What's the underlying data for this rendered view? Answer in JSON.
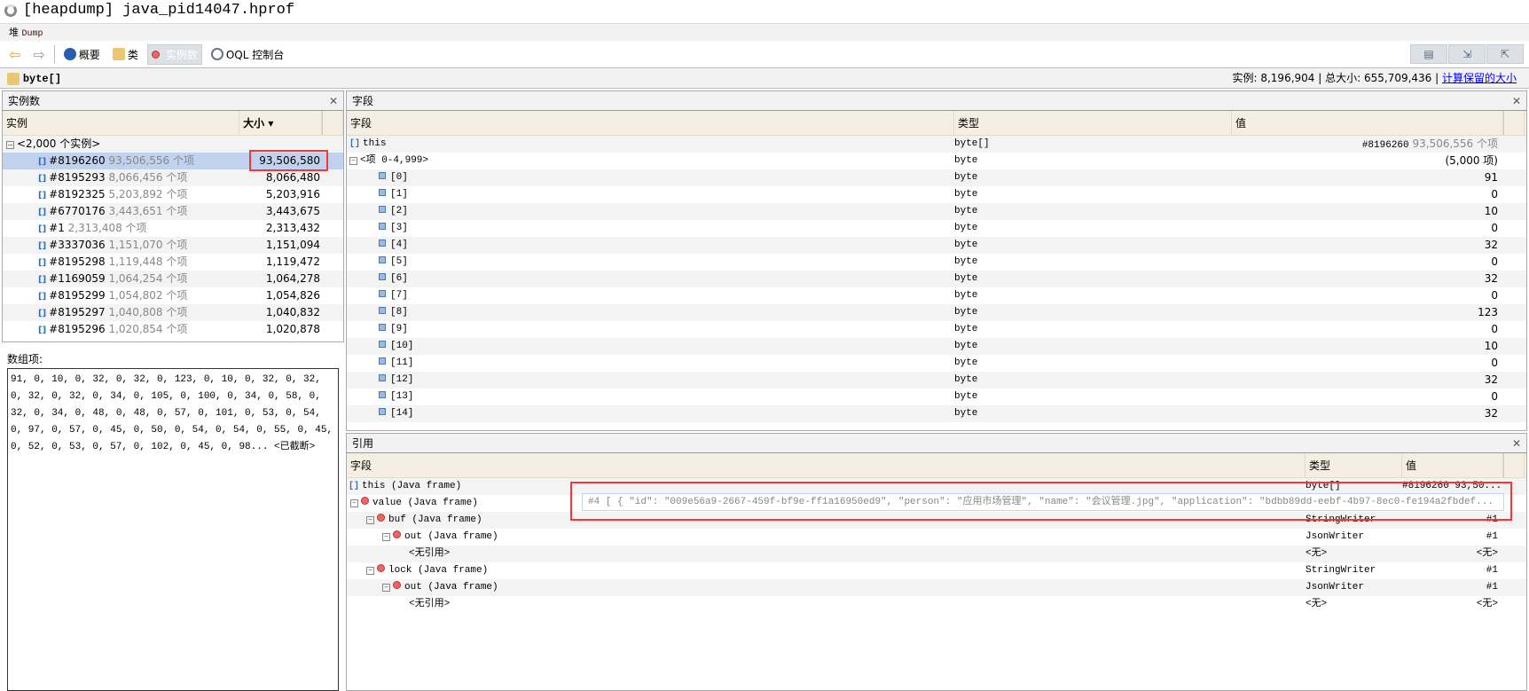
{
  "title": "[heapdump] java_pid14047.hprof",
  "tab": {
    "prefix": "堆",
    "label": "Dump"
  },
  "toolbar": {
    "summary": "概要",
    "classes": "类",
    "instances": "实例数",
    "oql": "OQL 控制台"
  },
  "class_bar": {
    "class_name": "byte[]",
    "instances_label": "实例:",
    "instances": "8,196,904",
    "total_label": "总大小:",
    "total": "655,709,436",
    "compute_link": "计算保留的大小"
  },
  "instances_panel": {
    "title": "实例数",
    "col_instance": "实例",
    "col_size": "大小",
    "group": "<2,000 个实例>",
    "rows": [
      {
        "id": "#8196260",
        "items": "93,506,556 个项",
        "size": "93,506,580"
      },
      {
        "id": "#8195293",
        "items": "8,066,456 个项",
        "size": "8,066,480"
      },
      {
        "id": "#8192325",
        "items": "5,203,892 个项",
        "size": "5,203,916"
      },
      {
        "id": "#6770176",
        "items": "3,443,651 个项",
        "size": "3,443,675"
      },
      {
        "id": "#1",
        "items": "2,313,408 个项",
        "size": "2,313,432"
      },
      {
        "id": "#3337036",
        "items": "1,151,070 个项",
        "size": "1,151,094"
      },
      {
        "id": "#8195298",
        "items": "1,119,448 个项",
        "size": "1,119,472"
      },
      {
        "id": "#1169059",
        "items": "1,064,254 个项",
        "size": "1,064,278"
      },
      {
        "id": "#8195299",
        "items": "1,054,802 个项",
        "size": "1,054,826"
      },
      {
        "id": "#8195297",
        "items": "1,040,808 个项",
        "size": "1,040,832"
      },
      {
        "id": "#8195296",
        "items": "1,020,854 个项",
        "size": "1,020,878"
      }
    ]
  },
  "array_items": {
    "label": "数组项:",
    "text": "91, 0, 10, 0, 32, 0, 32, 0, 123, 0, 10, 0, 32, 0, 32, 0, 32, 0, 32, 0, 34, 0, 105, 0, 100, 0, 34, 0, 58, 0, 32, 0, 34, 0, 48, 0, 48, 0, 57, 0, 101, 0, 53, 0, 54, 0, 97, 0, 57, 0, 45, 0, 50, 0, 54, 0, 54, 0, 55, 0, 45, 0, 52, 0, 53, 0, 57, 0, 102, 0, 45, 0, 98... <已截断>"
  },
  "fields_panel": {
    "title": "字段",
    "col_field": "字段",
    "col_type": "类型",
    "col_value": "值",
    "this": {
      "name": "this",
      "type": "byte[]",
      "id": "#8196260",
      "items": "93,506,556 个项"
    },
    "group": {
      "name": "<项 0-4,999>",
      "type": "byte",
      "value": "(5,000 项)"
    },
    "items": [
      {
        "name": "[0]",
        "type": "byte",
        "value": "91"
      },
      {
        "name": "[1]",
        "type": "byte",
        "value": "0"
      },
      {
        "name": "[2]",
        "type": "byte",
        "value": "10"
      },
      {
        "name": "[3]",
        "type": "byte",
        "value": "0"
      },
      {
        "name": "[4]",
        "type": "byte",
        "value": "32"
      },
      {
        "name": "[5]",
        "type": "byte",
        "value": "0"
      },
      {
        "name": "[6]",
        "type": "byte",
        "value": "32"
      },
      {
        "name": "[7]",
        "type": "byte",
        "value": "0"
      },
      {
        "name": "[8]",
        "type": "byte",
        "value": "123"
      },
      {
        "name": "[9]",
        "type": "byte",
        "value": "0"
      },
      {
        "name": "[10]",
        "type": "byte",
        "value": "10"
      },
      {
        "name": "[11]",
        "type": "byte",
        "value": "0"
      },
      {
        "name": "[12]",
        "type": "byte",
        "value": "32"
      },
      {
        "name": "[13]",
        "type": "byte",
        "value": "0"
      },
      {
        "name": "[14]",
        "type": "byte",
        "value": "32"
      }
    ]
  },
  "refs_panel": {
    "title": "引用",
    "col_field": "字段",
    "col_type": "类型",
    "col_value": "值",
    "rows": [
      {
        "name": "this (Java frame)",
        "type": "byte[]",
        "value": "#8196260  93,50..."
      },
      {
        "name": "value (Java frame)",
        "type": "",
        "value": ""
      },
      {
        "name": "buf (Java frame)",
        "type": "StringWriter",
        "value": "#1"
      },
      {
        "name": "out (Java frame)",
        "type": "JsonWriter",
        "value": "#1"
      },
      {
        "name": "<无引用>",
        "type": "<无>",
        "value": "<无>"
      },
      {
        "name": "lock (Java frame)",
        "type": "StringWriter",
        "value": "#1"
      },
      {
        "name": "out (Java frame)",
        "type": "JsonWriter",
        "value": "#1"
      },
      {
        "name": "<无引用>",
        "type": "<无>",
        "value": "<无>"
      }
    ],
    "tooltip": "#4  [  {     \"id\": \"009e56a9-2667-459f-bf9e-ff1a16950ed9\",     \"person\": \"应用市场管理\",     \"name\": \"会议管理.jpg\",     \"application\": \"bdbb89dd-eebf-4b97-8ec0-fe194a2fbdef..."
  }
}
